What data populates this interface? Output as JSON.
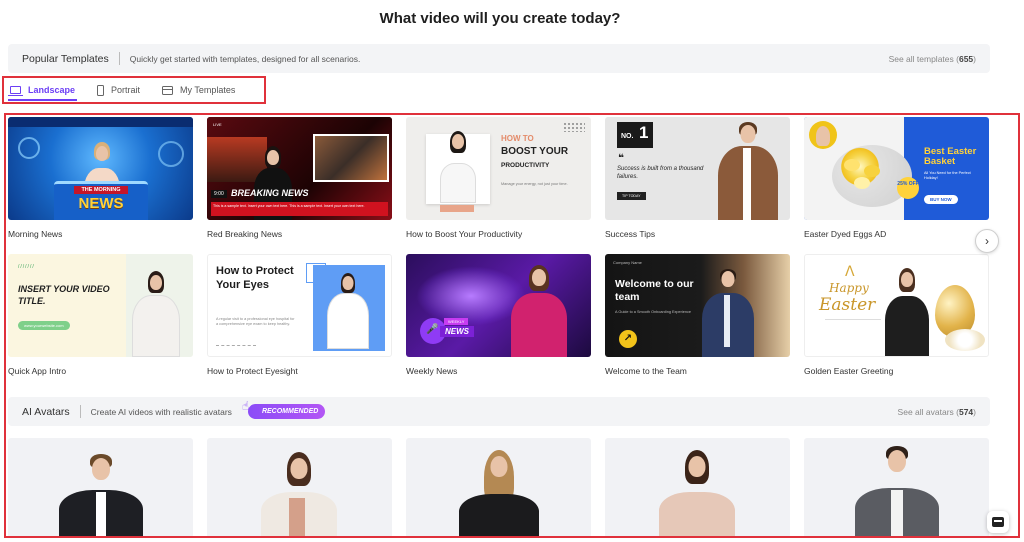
{
  "headline": "What video will you create today?",
  "templates_section": {
    "title": "Popular Templates",
    "description": "Quickly get started with templates, designed for all scenarios.",
    "see_all_text": "See all templates (",
    "see_all_count": "655",
    "see_all_close": ")"
  },
  "tabs": [
    {
      "label": "Landscape",
      "icon": "landscape-icon",
      "active": true
    },
    {
      "label": "Portrait",
      "icon": "portrait-phone-icon",
      "active": false
    },
    {
      "label": "My Templates",
      "icon": "my-templates-icon",
      "active": false
    }
  ],
  "templates_row1": [
    {
      "caption": "Morning News",
      "thumb_text": [
        "THE MORNING",
        "NEWS"
      ]
    },
    {
      "caption": "Red Breaking News",
      "thumb_text": [
        "LIVE",
        "9:00",
        "BREAKING NEWS",
        "This is a sample text. Insert your own text here. This is a sample text. Insert your own text here."
      ]
    },
    {
      "caption": "How to Boost Your Productivity",
      "thumb_text": [
        "HOW TO",
        "BOOST YOUR",
        "PRODUCTIVITY",
        "Manage your energy, not just your time."
      ]
    },
    {
      "caption": "Success Tips",
      "thumb_text": [
        "NO.",
        "1",
        "Success is built from a thousand failures.",
        "TIP TODAY"
      ]
    },
    {
      "caption": "Easter Dyed Eggs AD",
      "thumb_text": [
        "Best Easter Basket",
        "All You Need for the Perfect Holiday!",
        "25% OFF",
        "BUY NOW"
      ]
    }
  ],
  "templates_row2": [
    {
      "caption": "Quick App Intro",
      "thumb_text": [
        "INSERT YOUR VIDEO TITLE.",
        "www.yourwebsite.com"
      ]
    },
    {
      "caption": "How to Protect Eyesight",
      "thumb_text": [
        "How to Protect Your Eyes",
        "A regular visit to a professional eye hospital for a comprehensive eye exam to keep healthy."
      ]
    },
    {
      "caption": "Weekly News",
      "thumb_text": [
        "WEEKLY",
        "NEWS"
      ]
    },
    {
      "caption": "Welcome to the Team",
      "thumb_text": [
        "Company Name",
        "Welcome to our team",
        "A Guide to a Smooth Onboarding Experience"
      ]
    },
    {
      "caption": "Golden Easter Greeting",
      "thumb_text": [
        "Happy",
        "Easter"
      ]
    }
  ],
  "avatars_section": {
    "title": "AI Avatars",
    "description": "Create AI videos with realistic avatars",
    "badge": "RECOMMENDED",
    "see_all_text": "See all avatars (",
    "see_all_count": "574",
    "see_all_close": ")"
  },
  "icons": {
    "next": "chevron-right-icon",
    "chat": "inbox-chat-icon"
  },
  "colors": {
    "accent": "#6c3ff5",
    "highlight_frame": "#e0313b",
    "section_bg": "#f3f4f6"
  }
}
